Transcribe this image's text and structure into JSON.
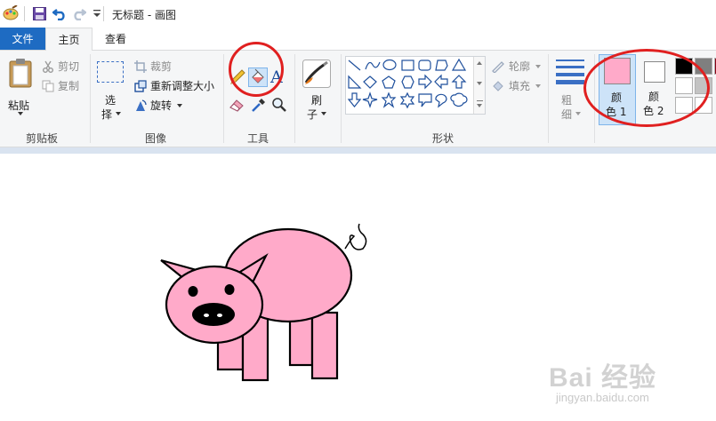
{
  "app": {
    "title": "无标题 - 画图"
  },
  "tabs": {
    "file": "文件",
    "home": "主页",
    "view": "查看"
  },
  "clipboard": {
    "paste": "粘贴",
    "cut": "剪切",
    "copy": "复制",
    "group_label": "剪贴板"
  },
  "image": {
    "select_1": "选",
    "select_2": "择",
    "crop": "裁剪",
    "resize": "重新调整大小",
    "rotate": "旋转",
    "group_label": "图像"
  },
  "tools": {
    "group_label": "工具",
    "text_glyph": "A"
  },
  "brushes": {
    "label_1": "刷",
    "label_2": "子"
  },
  "shapes": {
    "outline": "轮廓",
    "fill": "填充",
    "group_label": "形状"
  },
  "size": {
    "label_1": "粗",
    "label_2": "细"
  },
  "colors": {
    "color1_label_1": "颜",
    "color1_label_2": "色 1",
    "color2_label_1": "颜",
    "color2_label_2": "色 2",
    "color1": "#ffaac9",
    "color2": "#ffffff",
    "palette": [
      "#000000",
      "#7f7f7f",
      "#ffffff",
      "#c3c3c3",
      "#ffffff",
      "#ffffff"
    ]
  },
  "accent": {
    "file_tab": "#1e6bc2",
    "annotation": "#e02020",
    "pig": "#ffaac9"
  },
  "watermark": {
    "brand": "Bai 经验",
    "url": "jingyan.baidu.com"
  }
}
